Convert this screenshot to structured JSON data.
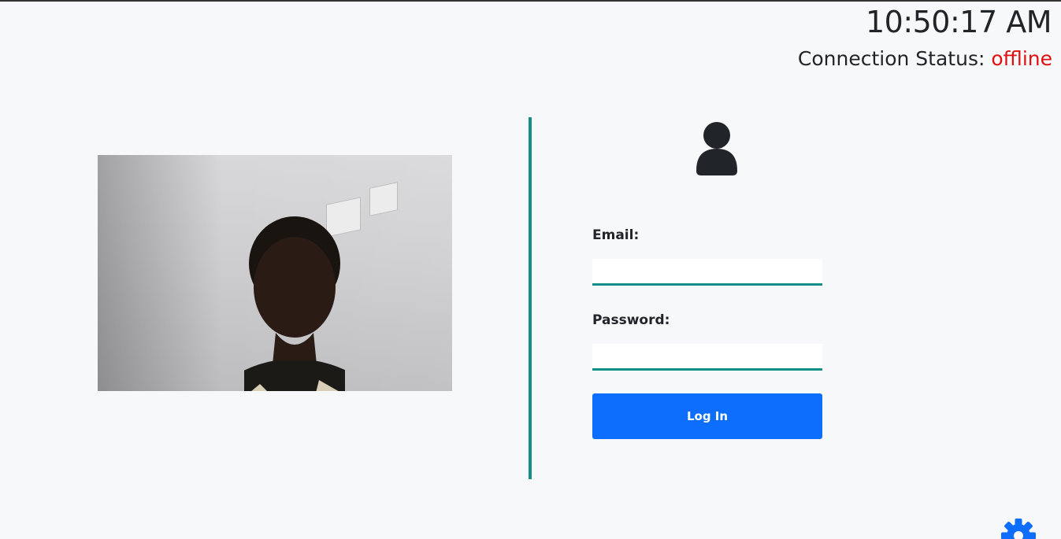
{
  "header": {
    "time": "10:50:17 AM",
    "status_label": "Connection Status:",
    "status_value": "offline",
    "status_color": "#e01010"
  },
  "camera": {
    "icon": "webcam-feed"
  },
  "login": {
    "user_icon": "user-icon",
    "email_label": "Email:",
    "email_value": "",
    "password_label": "Password:",
    "password_value": "",
    "button_label": "Log In",
    "accent_color": "#138f86",
    "button_color": "#0d6efd"
  },
  "settings": {
    "icon": "gear-icon"
  }
}
